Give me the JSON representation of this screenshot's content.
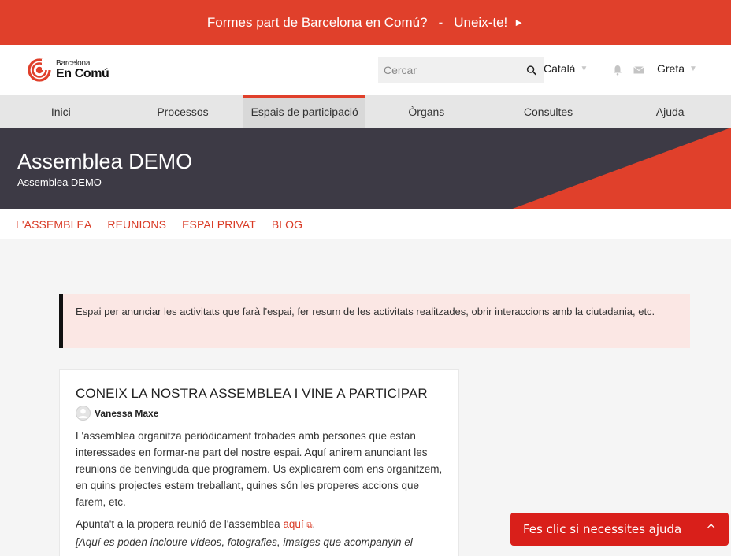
{
  "banner": {
    "question": "Formes part de Barcelona en Comú?",
    "separator": "-",
    "join_label": "Uneix-te!",
    "arrow": "►"
  },
  "header": {
    "logo_line1": "Barcelona",
    "logo_line2": "En Comú",
    "search_placeholder": "Cercar",
    "language": "Català",
    "user": "Greta"
  },
  "mainnav": {
    "items": [
      {
        "label": "Inici"
      },
      {
        "label": "Processos"
      },
      {
        "label": "Espais de participació"
      },
      {
        "label": "Òrgans"
      },
      {
        "label": "Consultes"
      },
      {
        "label": "Ajuda"
      }
    ]
  },
  "hero": {
    "title": "Assemblea DEMO",
    "subtitle": "Assemblea DEMO"
  },
  "subnav": {
    "items": [
      {
        "label": "L'ASSEMBLEA"
      },
      {
        "label": "REUNIONS"
      },
      {
        "label": "ESPAI PRIVAT"
      },
      {
        "label": "BLOG"
      }
    ]
  },
  "callout": {
    "text": "Espai per anunciar les activitats que farà l'espai, fer resum de les activitats realitzades, obrir interaccions amb la ciutadania, etc."
  },
  "post": {
    "title": "CONEIX LA NOSTRA ASSEMBLEA I VINE A PARTICIPAR",
    "author": "Vanessa Maxe",
    "body": "L'assemblea organitza periòdicament trobades amb persones que estan interessades en formar-ne part del nostre espai. Aquí anirem anunciant les reunions de benvinguda que programem. Us explicarem com ens organitzem, en quins projectes estem treballant, quines són les properes accions que farem, etc.",
    "cta_prefix": "Apunta't a la propera reunió de l'assemblea",
    "cta_link": "aquí",
    "cta_suffix": ".",
    "italic": "[Aquí es poden incloure vídeos, fotografies, imatges que acompanyin el"
  },
  "help": {
    "label": "Fes clic si necessites ajuda",
    "chevron": "^"
  },
  "colors": {
    "brand_red": "#e0402b",
    "hero_dark": "#3d3a45",
    "help_red": "#d91f1a"
  }
}
